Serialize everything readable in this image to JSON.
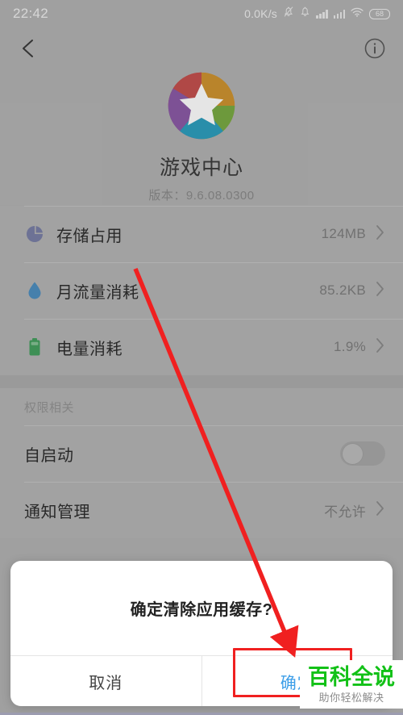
{
  "status_bar": {
    "time": "22:42",
    "network_speed": "0.0K/s",
    "battery_percent": "68",
    "icons": [
      "bell-muted-icon",
      "bell-icon",
      "signal-bars-icon",
      "signal-bars-icon",
      "wifi-icon",
      "battery-icon"
    ]
  },
  "app_bar": {
    "back_icon": "chevron-left-icon",
    "info_icon": "info-circle-icon"
  },
  "app_header": {
    "icon": "game-center-star-icon",
    "name": "游戏中心",
    "version": "版本：9.6.08.0300",
    "icon_colors": {
      "red": "#c4514f",
      "orange": "#cf9430",
      "green": "#7aab43",
      "teal": "#2e9fbe",
      "purple": "#8c5ba6",
      "star": "#ffffff"
    }
  },
  "usage_section": {
    "rows": [
      {
        "icon": "pie-chart-icon",
        "icon_color": "#7a7fa6",
        "label": "存储占用",
        "value": "124MB",
        "chevron": "chevron-right-icon"
      },
      {
        "icon": "water-drop-icon",
        "icon_color": "#4f8fc0",
        "label": "月流量消耗",
        "value": "85.2KB",
        "chevron": "chevron-right-icon"
      },
      {
        "icon": "battery-icon",
        "icon_color": "#46a05f",
        "label": "电量消耗",
        "value": "1.9%",
        "chevron": "chevron-right-icon"
      }
    ]
  },
  "permission_section": {
    "header": "权限相关",
    "rows": [
      {
        "label": "自启动",
        "control": "toggle",
        "toggle_on": false
      },
      {
        "label": "通知管理",
        "value": "不允许",
        "chevron": "chevron-right-icon"
      }
    ]
  },
  "dialog": {
    "message": "确定清除应用缓存?",
    "cancel_label": "取消",
    "confirm_label": "确定",
    "confirm_color": "#3c9ee8"
  },
  "annotation": {
    "arrow_color": "#f02020",
    "highlight_color": "#f02020"
  },
  "watermark": {
    "title": "百科全说",
    "subtitle": "助你轻松解决",
    "title_color": "#12c117"
  }
}
